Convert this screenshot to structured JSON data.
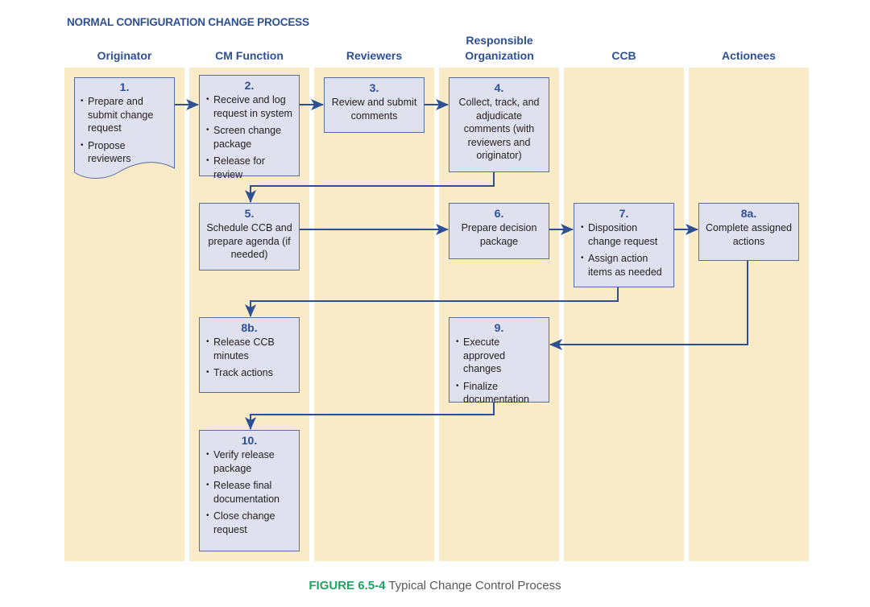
{
  "title": "NORMAL CONFIGURATION CHANGE PROCESS",
  "colors": {
    "lane_bg": "#faebc8",
    "box_fill": "#dfe1ef",
    "box_border": "#5a6e9e",
    "heading_blue": "#2e4f93",
    "arrow_blue": "#2e4f93",
    "caption_green": "#1fa363",
    "caption_gray": "#58595b"
  },
  "lanes": [
    {
      "label": "Originator"
    },
    {
      "label": "CM Function"
    },
    {
      "label": "Reviewers"
    },
    {
      "label": "Responsible Organization"
    },
    {
      "label": "CCB"
    },
    {
      "label": "Actionees"
    }
  ],
  "steps": {
    "s1": {
      "num": "1.",
      "bullets": [
        "Prepare and submit change request",
        "Propose reviewers"
      ]
    },
    "s2": {
      "num": "2.",
      "bullets": [
        "Receive and log request in system",
        "Screen change package",
        "Release for review"
      ]
    },
    "s3": {
      "num": "3.",
      "text": "Review and submit comments"
    },
    "s4": {
      "num": "4.",
      "text": "Collect, track, and adjudicate comments (with reviewers and originator)"
    },
    "s5": {
      "num": "5.",
      "text": "Schedule CCB and prepare agenda (if needed)"
    },
    "s6": {
      "num": "6.",
      "text": "Prepare decision package"
    },
    "s7": {
      "num": "7.",
      "bullets": [
        "Disposition change request",
        "Assign action items as needed"
      ]
    },
    "s8a": {
      "num": "8a.",
      "text": "Complete assigned actions"
    },
    "s8b": {
      "num": "8b.",
      "bullets": [
        "Release CCB minutes",
        "Track actions"
      ]
    },
    "s9": {
      "num": "9.",
      "bullets": [
        "Execute approved changes",
        "Finalize documentation"
      ]
    },
    "s10": {
      "num": "10.",
      "bullets": [
        "Verify release package",
        "Release final documentation",
        "Close change request"
      ]
    }
  },
  "flows": [
    {
      "from": "1.",
      "to": "2."
    },
    {
      "from": "2.",
      "to": "3."
    },
    {
      "from": "3.",
      "to": "4."
    },
    {
      "from": "4.",
      "to": "5."
    },
    {
      "from": "5.",
      "to": "6."
    },
    {
      "from": "6.",
      "to": "7."
    },
    {
      "from": "7.",
      "to": "8a."
    },
    {
      "from": "7.",
      "to": "8b."
    },
    {
      "from": "8a.",
      "to": "9."
    },
    {
      "from": "9.",
      "to": "10."
    }
  ],
  "caption": {
    "figure": "FIGURE 6.5-4",
    "text": "Typical Change Control Process"
  }
}
